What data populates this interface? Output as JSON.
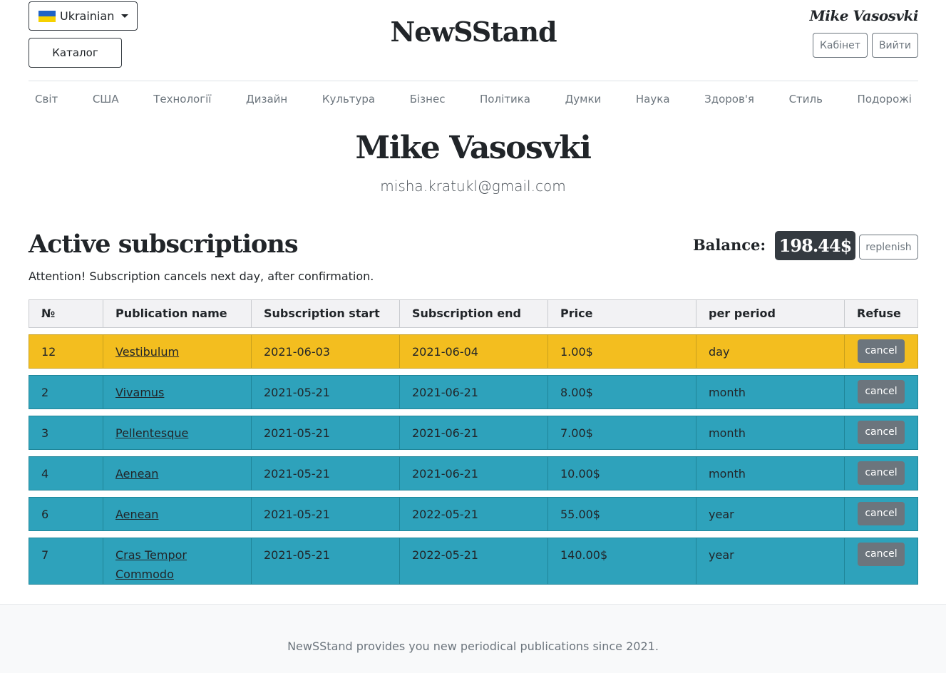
{
  "header": {
    "language": "Ukrainian",
    "catalog_label": "Каталог",
    "brand": "NewSStand",
    "user_name": "Mike Vasosvki",
    "cabinet_label": "Кабінет",
    "logout_label": "Вийти"
  },
  "nav": [
    "Світ",
    "США",
    "Технології",
    "Дизайн",
    "Культура",
    "Бізнес",
    "Політика",
    "Думки",
    "Наука",
    "Здоров'я",
    "Стиль",
    "Подорожі"
  ],
  "profile": {
    "name": "Mike Vasosvki",
    "email": "misha.kratukl@gmail.com"
  },
  "subscriptions": {
    "title": "Active subscriptions",
    "balance_label": "Balance:",
    "balance_value": "198.44$",
    "replenish_label": "replenish",
    "attention": "Attention! Subscription cancels next day, after confirmation.",
    "columns": [
      "№",
      "Publication name",
      "Subscription start",
      "Subscription end",
      "Price",
      "per period",
      "Refuse"
    ],
    "cancel_label": "cancel",
    "rows": [
      {
        "no": "12",
        "name": "Vestibulum",
        "start": "2021-06-03",
        "end": "2021-06-04",
        "price": "1.00$",
        "period": "day"
      },
      {
        "no": "2",
        "name": "Vivamus",
        "start": "2021-05-21",
        "end": "2021-06-21",
        "price": "8.00$",
        "period": "month"
      },
      {
        "no": "3",
        "name": "Pellentesque",
        "start": "2021-05-21",
        "end": "2021-06-21",
        "price": "7.00$",
        "period": "month"
      },
      {
        "no": "4",
        "name": "Aenean",
        "start": "2021-05-21",
        "end": "2021-06-21",
        "price": "10.00$",
        "period": "month"
      },
      {
        "no": "6",
        "name": "Aenean",
        "start": "2021-05-21",
        "end": "2022-05-21",
        "price": "55.00$",
        "period": "year"
      },
      {
        "no": "7",
        "name": "Cras Tempor Commodo",
        "start": "2021-05-21",
        "end": "2022-05-21",
        "price": "140.00$",
        "period": "year"
      }
    ]
  },
  "footer": {
    "text": "NewSStand provides you new periodical publications since 2021."
  },
  "colors": {
    "warning_row": "#f3be1f",
    "info_row": "#2ea2bb",
    "dark": "#343a40",
    "secondary": "#6c757d"
  }
}
